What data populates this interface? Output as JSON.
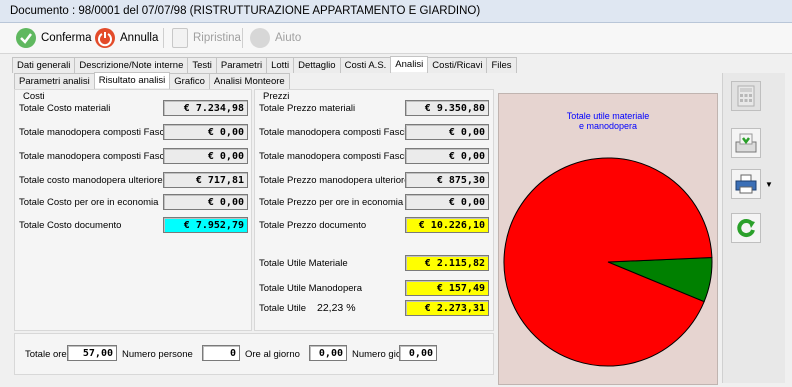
{
  "window": {
    "title": "Documento : 98/0001 del 07/07/98 (RISTRUTTURAZIONE APPARTAMENTO E GIARDINO)"
  },
  "toolbar": {
    "confirm": "Conferma",
    "cancel": "Annulla",
    "restore": "Ripristina",
    "help": "Aiuto"
  },
  "tabs": [
    "Dati generali",
    "Descrizione/Note interne",
    "Testi",
    "Parametri",
    "Lotti",
    "Dettaglio",
    "Costi A.S.",
    "Analisi",
    "Costi/Ricavi",
    "Files"
  ],
  "subtabs": [
    "Parametri analisi",
    "Risultato analisi",
    "Grafico",
    "Analisi Monteore"
  ],
  "costi": {
    "legend": "Costi",
    "rows": [
      {
        "label": "Totale Costo materiali",
        "value": "€ 7.234,98"
      },
      {
        "label": "Totale manodopera composti Fascia A",
        "value": "€ 0,00"
      },
      {
        "label": "Totale manodopera composti Fascia B",
        "value": "€ 0,00"
      },
      {
        "label": "Totale costo manodopera ulteriore",
        "value": "€ 717,81"
      },
      {
        "label": "Totale Costo per ore in economia",
        "value": "€ 0,00"
      },
      {
        "label": "Totale Costo documento",
        "value": "€ 7.952,79"
      }
    ]
  },
  "prezzi": {
    "legend": "Prezzi",
    "rows": [
      {
        "label": "Totale Prezzo materiali",
        "value": "€ 9.350,80"
      },
      {
        "label": "Totale manodopera composti Fascia A",
        "value": "€ 0,00"
      },
      {
        "label": "Totale manodopera composti Fascia B",
        "value": "€ 0,00"
      },
      {
        "label": "Totale Prezzo manodopera ulteriore",
        "value": "€ 875,30"
      },
      {
        "label": "Totale Prezzo per ore in economia",
        "value": "€ 0,00"
      },
      {
        "label": "Totale Prezzo documento",
        "value": "€ 10.226,10"
      }
    ],
    "utili": [
      {
        "label": "Totale Utile Materiale",
        "value": "€ 2.115,82"
      },
      {
        "label": "Totale Utile Manodopera",
        "value": "€ 157,49"
      },
      {
        "label": "Totale Utile",
        "value": "€ 2.273,31"
      }
    ],
    "utile_percent": "22,23 %"
  },
  "bottom": {
    "ore_label": "Totale ore",
    "ore_value": "57,00",
    "persone_label": "Numero persone",
    "persone_value": "0",
    "giorno_label": "Ore al giorno",
    "giorno_value": "0,00",
    "giorni_label": "Numero giorni",
    "giorni_value": "0,00"
  },
  "chart_data": {
    "type": "pie",
    "title": "Totale utile materiale\ne manodopera",
    "slices": [
      {
        "label": "Totale Utile Materiale",
        "value": 2115.82,
        "color": "#ff0000"
      },
      {
        "label": "Totale Utile Manodopera",
        "value": 157.49,
        "color": "#008000"
      }
    ]
  },
  "colors": {
    "title_text": "#0000ff"
  },
  "icons": {
    "confirm": "check-icon",
    "cancel": "power-icon",
    "restore": "restore-icon",
    "help": "help-icon",
    "calc": "calculator-icon",
    "save": "save-disk-icon",
    "print": "printer-icon",
    "refresh": "refresh-icon"
  }
}
